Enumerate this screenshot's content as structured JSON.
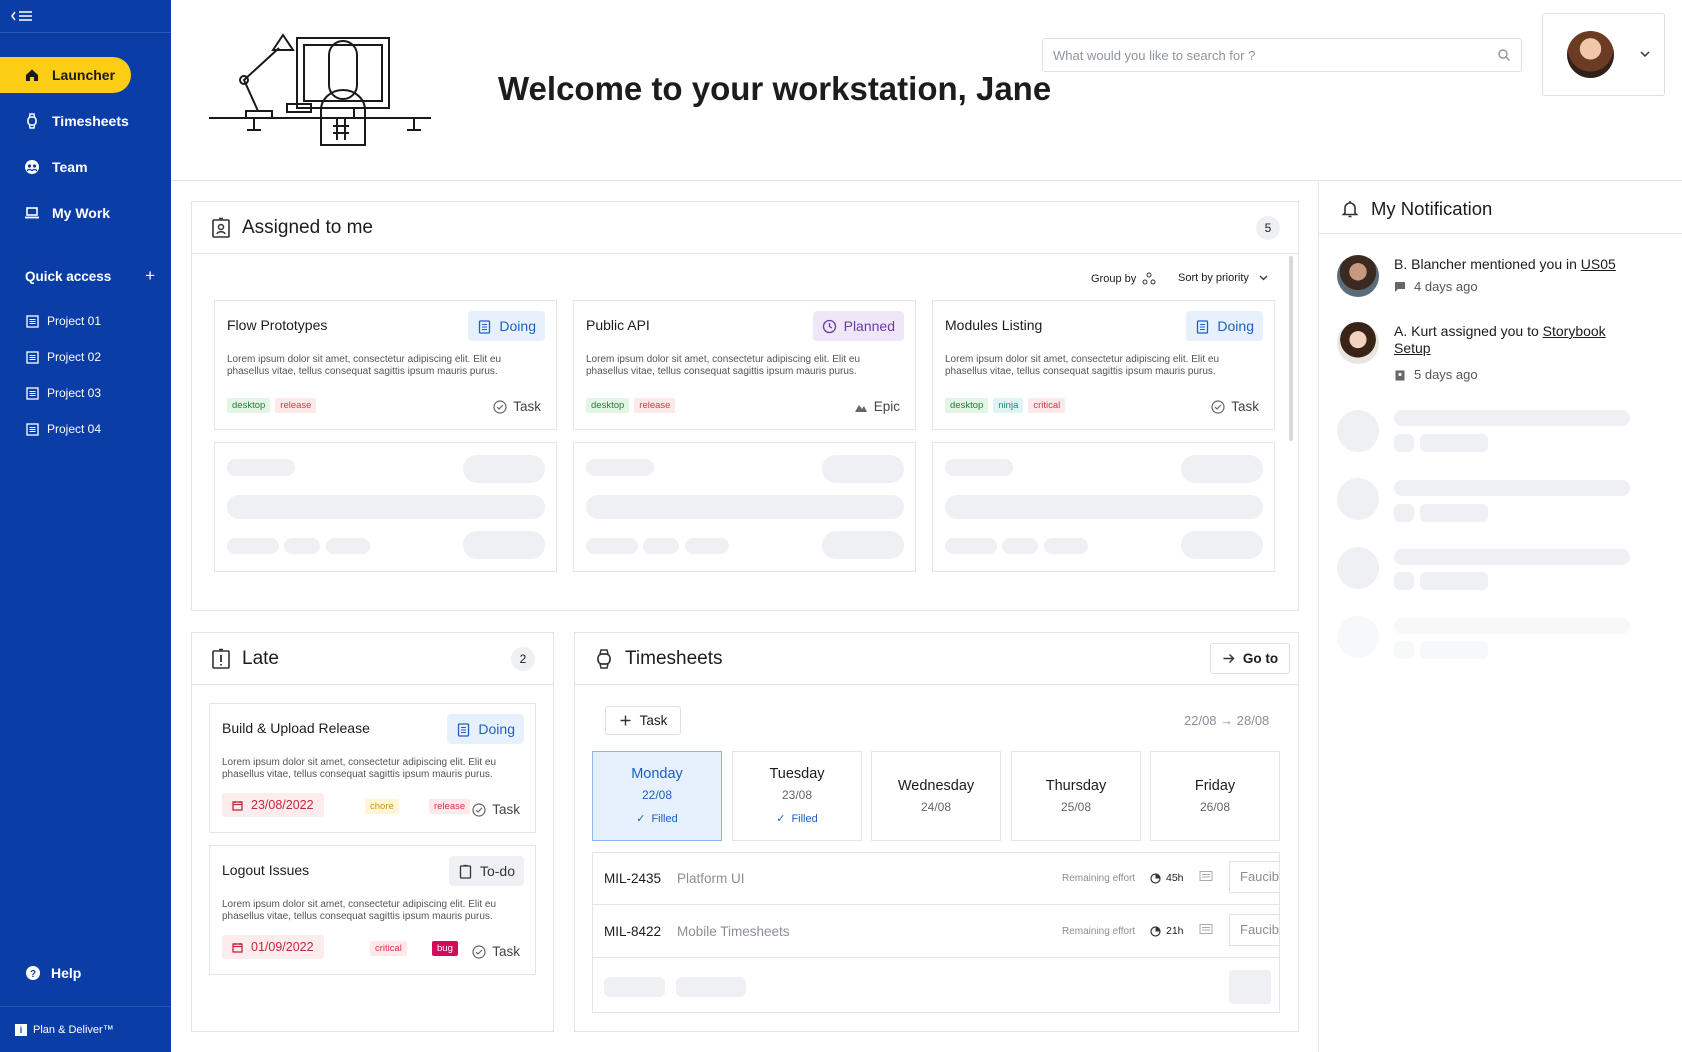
{
  "sidebar": {
    "nav": [
      {
        "label": "Launcher",
        "icon": "home-icon"
      },
      {
        "label": "Timesheets",
        "icon": "watch-icon"
      },
      {
        "label": "Team",
        "icon": "team-icon"
      },
      {
        "label": "My Work",
        "icon": "laptop-icon"
      }
    ],
    "quick_access_label": "Quick access",
    "projects": [
      "Project 01",
      "Project 02",
      "Project 03",
      "Project 04"
    ],
    "help_label": "Help",
    "brand": "Plan & Deliver™"
  },
  "header": {
    "welcome": "Welcome to your workstation, Jane",
    "search_placeholder": "What would you like to search for ?"
  },
  "assigned": {
    "title": "Assigned to me",
    "count": "5",
    "group_by": "Group by",
    "sort_by": "Sort by priority",
    "cards": [
      {
        "title": "Flow Prototypes",
        "status": "Doing",
        "desc": "Lorem ipsum dolor sit amet, consectetur adipiscing elit. Elit eu phasellus vitae, tellus consequat sagittis ipsum mauris purus.",
        "tags": [
          "desktop",
          "release"
        ],
        "type": "Task"
      },
      {
        "title": "Public API",
        "status": "Planned",
        "desc": "Lorem ipsum dolor sit amet, consectetur adipiscing elit. Elit eu phasellus vitae, tellus consequat sagittis ipsum mauris purus.",
        "tags": [
          "desktop",
          "release"
        ],
        "type": "Epic"
      },
      {
        "title": "Modules Listing",
        "status": "Doing",
        "desc": "Lorem ipsum dolor sit amet, consectetur adipiscing elit. Elit eu phasellus vitae, tellus consequat sagittis ipsum mauris purus.",
        "tags": [
          "desktop",
          "ninja",
          "critical"
        ],
        "type": "Task"
      }
    ]
  },
  "late": {
    "title": "Late",
    "count": "2",
    "cards": [
      {
        "title": "Build & Upload Release",
        "status": "Doing",
        "desc": "Lorem ipsum dolor sit amet, consectetur adipiscing elit. Elit eu phasellus vitae, tellus consequat sagittis ipsum mauris purus.",
        "date": "23/08/2022",
        "tags": [
          "chore",
          "release"
        ],
        "type": "Task"
      },
      {
        "title": "Logout Issues",
        "status": "To-do",
        "desc": "Lorem ipsum dolor sit amet, consectetur adipiscing elit. Elit eu phasellus vitae, tellus consequat sagittis ipsum mauris purus.",
        "date": "01/09/2022",
        "tags": [
          "critical",
          "bug"
        ],
        "type": "Task"
      }
    ]
  },
  "timesheets": {
    "title": "Timesheets",
    "goto": "Go to",
    "add_task": "Task",
    "range": "22/08 → 28/08",
    "days": [
      {
        "name": "Monday",
        "date": "22/08",
        "status": "Filled"
      },
      {
        "name": "Tuesday",
        "date": "23/08",
        "status": "Filled"
      },
      {
        "name": "Wednesday",
        "date": "24/08",
        "status": ""
      },
      {
        "name": "Thursday",
        "date": "25/08",
        "status": ""
      },
      {
        "name": "Friday",
        "date": "26/08",
        "status": ""
      }
    ],
    "rows": [
      {
        "id": "MIL-2435",
        "name": "Platform UI",
        "remaining_label": "Remaining effort",
        "hours": "45h",
        "input": "Faucib"
      },
      {
        "id": "MIL-8422",
        "name": "Mobile Timesheets",
        "remaining_label": "Remaining effort",
        "hours": "21h",
        "input": "Faucib"
      }
    ]
  },
  "notifications": {
    "title": "My Notification",
    "items": [
      {
        "text": "B. Blancher mentioned you in ",
        "link": "US05",
        "time": "4 days ago"
      },
      {
        "text": "A. Kurt assigned you to ",
        "link": "Storybook Setup",
        "time": "5 days ago"
      }
    ]
  },
  "colors": {
    "sidebar": "#0a3ea6",
    "accent": "#fbcd14",
    "doing": "#1d5fc4",
    "late": "#c4283e"
  }
}
